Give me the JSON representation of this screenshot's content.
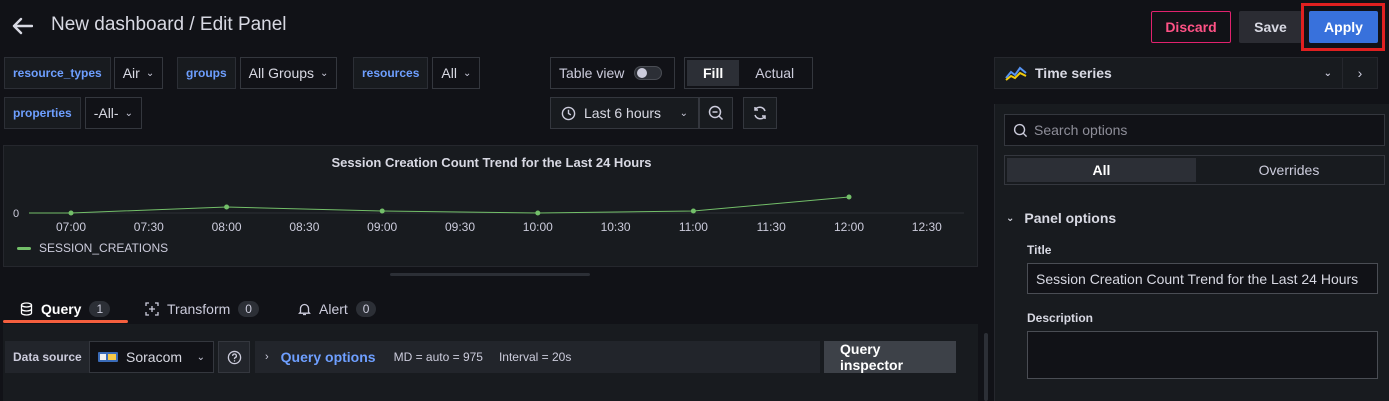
{
  "header": {
    "title": "New dashboard / Edit Panel",
    "discard_label": "Discard",
    "save_label": "Save",
    "apply_label": "Apply"
  },
  "variables": [
    {
      "label": "resource_types",
      "value": "Air"
    },
    {
      "label": "groups",
      "value": "All Groups"
    },
    {
      "label": "resources",
      "value": "All"
    },
    {
      "label": "properties",
      "value": "-All-"
    }
  ],
  "controls": {
    "table_view_label": "Table view",
    "table_view_on": false,
    "fill_label": "Fill",
    "actual_label": "Actual",
    "time_range": "Last 6 hours"
  },
  "chart_data": {
    "type": "line",
    "title": "Session Creation Count Trend for the Last 24 Hours",
    "x_ticks": [
      "07:00",
      "07:30",
      "08:00",
      "08:30",
      "09:00",
      "09:30",
      "10:00",
      "10:30",
      "11:00",
      "11:30",
      "12:00",
      "12:30"
    ],
    "y_ticks": [
      "0"
    ],
    "x": [
      "07:00",
      "08:00",
      "09:00",
      "10:00",
      "11:00",
      "12:00"
    ],
    "series": [
      {
        "name": "SESSION_CREATIONS",
        "values": [
          0,
          0.3,
          0.1,
          0,
          0.1,
          0.8
        ],
        "color": "#73bf69"
      }
    ]
  },
  "tabs": [
    {
      "label": "Query",
      "count": "1",
      "active": true
    },
    {
      "label": "Transform",
      "count": "0",
      "active": false
    },
    {
      "label": "Alert",
      "count": "0",
      "active": false
    }
  ],
  "query": {
    "datasource_label": "Data source",
    "datasource": "Soracom",
    "options_label": "Query options",
    "md_text": "MD = auto = 975",
    "interval_text": "Interval = 20s",
    "inspector_label": "Query inspector"
  },
  "options_pane": {
    "visualization": "Time series",
    "search_placeholder": "Search options",
    "tab_all": "All",
    "tab_overrides": "Overrides",
    "section": "Panel options",
    "title_label": "Title",
    "title_value": "Session Creation Count Trend for the Last 24 Hours",
    "description_label": "Description"
  },
  "colors": {
    "accent": "#3871dc",
    "danger": "#e0226e",
    "series": "#73bf69",
    "tab_underline": "#f55f3e"
  }
}
